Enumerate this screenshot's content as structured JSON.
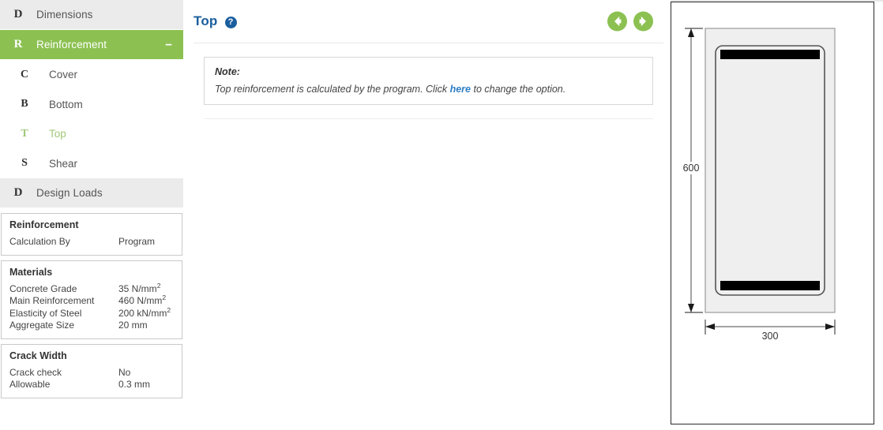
{
  "sidebar": {
    "nav": [
      {
        "icon": "D",
        "label": "Dimensions",
        "state": "normal",
        "name": "sidebar-item-dimensions"
      },
      {
        "icon": "R",
        "label": "Reinforcement",
        "state": "active",
        "toggle": "−",
        "name": "sidebar-item-reinforcement"
      }
    ],
    "subnav": [
      {
        "icon": "C",
        "label": "Cover",
        "state": "normal",
        "name": "sidebar-subitem-cover"
      },
      {
        "icon": "B",
        "label": "Bottom",
        "state": "normal",
        "name": "sidebar-subitem-bottom"
      },
      {
        "icon": "T",
        "label": "Top",
        "state": "selected",
        "name": "sidebar-subitem-top"
      },
      {
        "icon": "S",
        "label": "Shear",
        "state": "normal",
        "name": "sidebar-subitem-shear"
      }
    ],
    "nav2": [
      {
        "icon": "D",
        "label": "Design Loads",
        "state": "normal",
        "name": "sidebar-item-design-loads"
      }
    ],
    "panels": [
      {
        "title": "Reinforcement",
        "rows": [
          {
            "key": "Calculation By",
            "value": "Program",
            "sup": ""
          }
        ]
      },
      {
        "title": "Materials",
        "rows": [
          {
            "key": "Concrete Grade",
            "value": "35 N/mm",
            "sup": "2"
          },
          {
            "key": "Main Reinforcement",
            "value": "460 N/mm",
            "sup": "2"
          },
          {
            "key": "Elasticity of Steel",
            "value": "200 kN/mm",
            "sup": "2"
          },
          {
            "key": "Aggregate Size",
            "value": "20 mm",
            "sup": ""
          }
        ]
      },
      {
        "title": "Crack Width",
        "rows": [
          {
            "key": "Crack check",
            "value": "No",
            "sup": ""
          },
          {
            "key": "Allowable",
            "value": "0.3 mm",
            "sup": ""
          }
        ]
      }
    ]
  },
  "main": {
    "title": "Top",
    "help_icon": "?",
    "prev_label": "Previous",
    "next_label": "Next",
    "note": {
      "label": "Note:",
      "text_before": "Top reinforcement is calculated by the program. Click ",
      "link": "here",
      "text_after": " to change the option."
    }
  },
  "diagram": {
    "name": "beam-cross-section",
    "depth_label": "600",
    "width_label": "300",
    "depth_value": 600,
    "width_value": 300,
    "units": "mm",
    "colors": {
      "concrete_fill": "#efefef",
      "concrete_stroke": "#9a9a9a",
      "stirrup_stroke": "#555555",
      "rebar_fill": "#000000",
      "dimension_line": "#4a4a4a"
    }
  },
  "theme": {
    "accent_green": "#8cc152",
    "link_blue": "#2f7fc4",
    "title_blue": "#1b5e9e",
    "sidebar_row_bg": "#ebebeb"
  }
}
